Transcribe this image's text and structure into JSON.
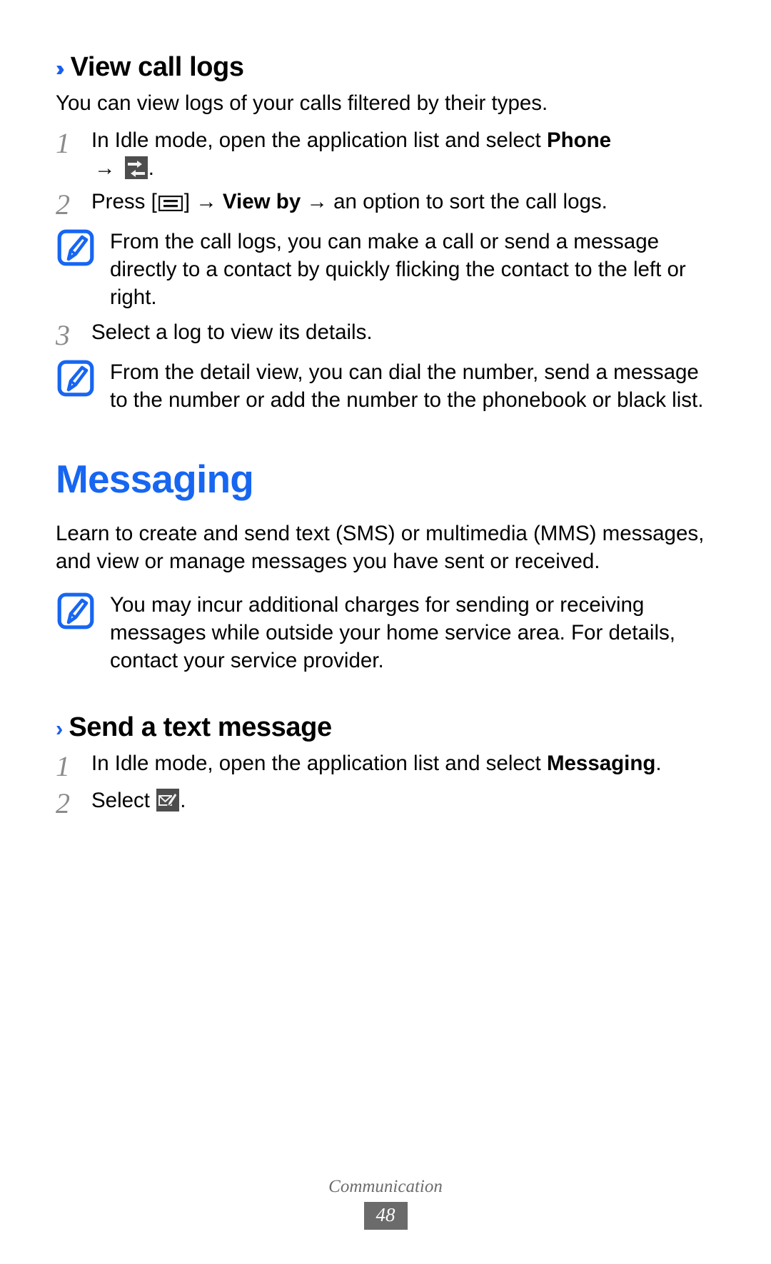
{
  "section1": {
    "heading": "View call logs",
    "chevron": "››",
    "intro": "You can view logs of your calls filtered by their types.",
    "steps": [
      {
        "num": "1",
        "text_before": "In Idle mode, open the application list and select ",
        "bold": "Phone",
        "text_after_arrow": ".",
        "icon": "call-logs-icon"
      },
      {
        "num": "2",
        "pre": "Press [",
        "key_icon": "menu-key-icon",
        "mid": "] → ",
        "bold": "View by",
        "post": " → an option to sort the call logs."
      },
      {
        "num": "3",
        "text": "Select a log to view its details."
      }
    ],
    "notes": [
      "From the call logs, you can make a call or send a message directly to a contact by quickly flicking the contact to the left or right.",
      "From the detail view, you can dial the number, send a message to the number or add the number to the phonebook or black list."
    ]
  },
  "section2": {
    "heading": "Messaging",
    "body": "Learn to create and send text (SMS) or multimedia (MMS) messages, and view or manage messages you have sent or received.",
    "note": "You may incur additional charges for sending or receiving messages while outside your home service area. For details, contact your service provider.",
    "subsection": {
      "chevron": "›",
      "heading": "Send a text message",
      "steps": [
        {
          "num": "1",
          "text_before": "In Idle mode, open the application list and select ",
          "bold": "Messaging",
          "text_after": "."
        },
        {
          "num": "2",
          "text_before": "Select ",
          "icon": "compose-message-icon",
          "text_after": "."
        }
      ]
    }
  },
  "footer": {
    "title": "Communication",
    "page_number": "48"
  },
  "colors": {
    "accent_blue": "#1766f2",
    "chevron_blue": "#1a5ff0",
    "step_number_gray": "#8b8b8b",
    "footer_gray": "#6d6d6d",
    "badge_gray": "#6b6b6b",
    "icon_dark": "#4a4a4a"
  }
}
